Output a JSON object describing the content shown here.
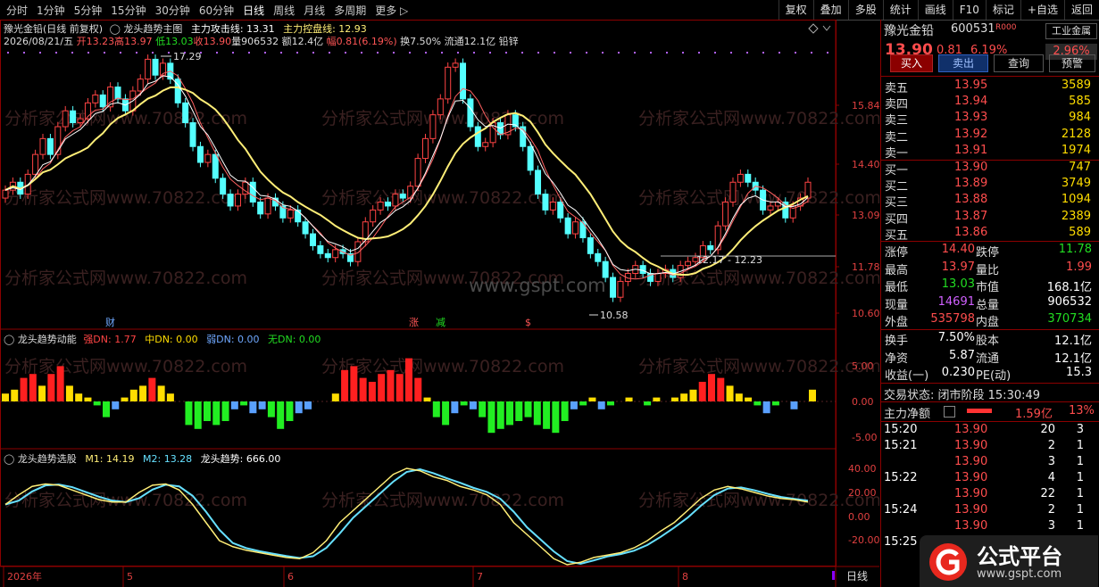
{
  "toolbar": {
    "periods": [
      "分时",
      "1分钟",
      "5分钟",
      "15分钟",
      "30分钟",
      "60分钟",
      "日线",
      "周线",
      "月线",
      "多周期",
      "更多 ▷"
    ],
    "right": [
      "复权",
      "叠加",
      "多股",
      "统计",
      "画线",
      "F10",
      "标记",
      "+自选",
      "返回"
    ]
  },
  "main": {
    "name_line": "豫光金铅(日线 前复权)",
    "indicator_name": "龙头趋势主图",
    "attack_label": "主力攻击线: 13.31",
    "control_label": "主力控盘线: 12.93",
    "date": "2026/08/21/五",
    "open": "开13.23",
    "high": "高13.97",
    "low": "低13.03",
    "close": "收13.90",
    "volume": "量906532",
    "amount": "额12.4亿",
    "amp": "幅0.81(6.19%)",
    "turnover": "换7.50% 流通12.1亿 铅锌",
    "yaxis": [
      "15.84",
      "14.40",
      "13.09",
      "11.78",
      "10.60"
    ],
    "peak_label": "17.29",
    "trough_label": "10.58",
    "range_label": "12.17 - 12.23",
    "markers": [
      {
        "t": "财",
        "c": "#6fa8ff"
      },
      {
        "t": "涨",
        "c": "#ff5555"
      },
      {
        "t": "减",
        "c": "#22dd22"
      },
      {
        "t": "$",
        "c": "#ff5555"
      }
    ],
    "watermark": "www.gspt.com"
  },
  "sub1": {
    "title": "龙头趋势动能",
    "strong": "强DN: 1.77",
    "mid": "中DN: 0.00",
    "weak": "弱DN: 0.00",
    "none": "无DN: 0.00",
    "yaxis": [
      "5.00",
      "0.00",
      "-5.00"
    ]
  },
  "sub2": {
    "title": "龙头趋势选股",
    "m1": "M1: 14.19",
    "m2": "M2: 13.28",
    "trend": "龙头趋势: 666.00",
    "yaxis": [
      "40.00",
      "20.00",
      "0.00",
      "-20.00"
    ]
  },
  "xaxis": {
    "labels": [
      "2026年",
      "5",
      "6",
      "7",
      "8"
    ],
    "period": "日线"
  },
  "watermark_text": "分析家公式网www.70822.com",
  "quote": {
    "name": "豫光金铅",
    "code": "600531",
    "tag": "R000",
    "industry": "工业金属",
    "price": "13.90",
    "change": "0.81",
    "pct": "6.19%",
    "industry_pct": "2.96%",
    "buttons": [
      "买入",
      "卖出",
      "查询",
      "预警"
    ],
    "asks": [
      {
        "l": "卖五",
        "p": "13.95",
        "v": "3589"
      },
      {
        "l": "卖四",
        "p": "13.94",
        "v": "585"
      },
      {
        "l": "卖三",
        "p": "13.93",
        "v": "984"
      },
      {
        "l": "卖二",
        "p": "13.92",
        "v": "2128"
      },
      {
        "l": "卖一",
        "p": "13.91",
        "v": "1974"
      }
    ],
    "bids": [
      {
        "l": "买一",
        "p": "13.90",
        "v": "747"
      },
      {
        "l": "买二",
        "p": "13.89",
        "v": "3749"
      },
      {
        "l": "买三",
        "p": "13.88",
        "v": "1094"
      },
      {
        "l": "买四",
        "p": "13.87",
        "v": "2389"
      },
      {
        "l": "买五",
        "p": "13.86",
        "v": "589"
      }
    ],
    "stats": [
      {
        "l1": "涨停",
        "v1": "14.40",
        "c1": "red",
        "l2": "跌停",
        "v2": "11.78",
        "c2": "green"
      },
      {
        "l1": "最高",
        "v1": "13.97",
        "c1": "red",
        "l2": "量比",
        "v2": "1.99",
        "c2": "red"
      },
      {
        "l1": "最低",
        "v1": "13.03",
        "c1": "green",
        "l2": "市值",
        "v2": "168.1亿",
        "c2": "white"
      },
      {
        "l1": "现量",
        "v1": "14691",
        "c1": "purple",
        "l2": "总量",
        "v2": "906532",
        "c2": "white"
      },
      {
        "l1": "外盘",
        "v1": "535798",
        "c1": "red",
        "l2": "内盘",
        "v2": "370734",
        "c2": "green"
      }
    ],
    "stats2": [
      {
        "l1": "换手",
        "v1": "7.50%",
        "l2": "股本",
        "v2": "12.1亿"
      },
      {
        "l1": "净资",
        "v1": "5.87",
        "l2": "流通",
        "v2": "12.1亿"
      },
      {
        "l1": "收益(一)",
        "v1": "0.230",
        "l2": "PE(动)",
        "v2": "15.3"
      }
    ],
    "status": "交易状态: 闭市阶段 15:30:49",
    "net_label": "主力净额",
    "net_value": "1.59亿",
    "net_pct": "13%",
    "ticks": [
      {
        "t": "15:20",
        "p": "13.90",
        "v": "20",
        "n": "3"
      },
      {
        "t": "15:21",
        "p": "13.90",
        "v": "2",
        "n": "1"
      },
      {
        "t": "",
        "p": "13.90",
        "v": "3",
        "n": "1"
      },
      {
        "t": "15:22",
        "p": "13.90",
        "v": "4",
        "n": "1"
      },
      {
        "t": "",
        "p": "13.90",
        "v": "22",
        "n": "1"
      },
      {
        "t": "15:24",
        "p": "13.90",
        "v": "2",
        "n": "1"
      },
      {
        "t": "",
        "p": "13.90",
        "v": "3",
        "n": "1"
      },
      {
        "t": "15:25",
        "p": "",
        "v": "",
        "n": ""
      }
    ]
  },
  "logo": {
    "text": "公式平台",
    "url": "www.gspt.com"
  }
}
